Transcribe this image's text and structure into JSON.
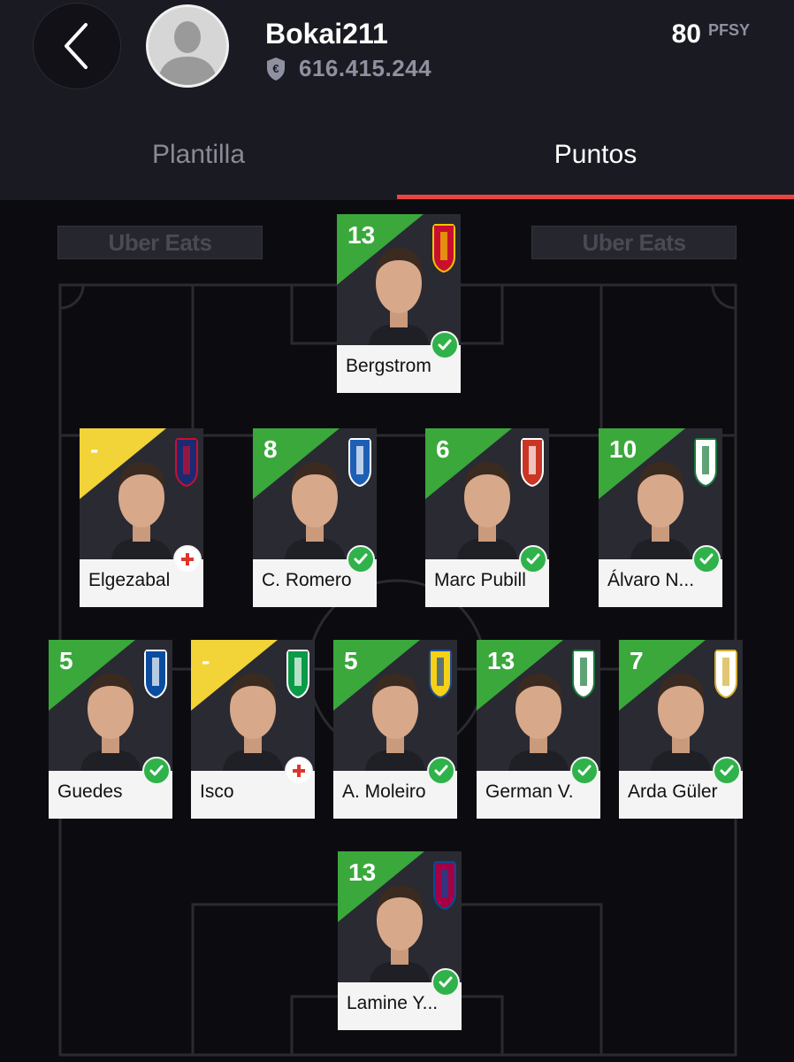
{
  "header": {
    "username": "Bokai211",
    "money": "616.415.244",
    "points": "80",
    "points_unit": "PFSY"
  },
  "tabs": [
    {
      "label": "Plantilla",
      "active": false
    },
    {
      "label": "Puntos",
      "active": true
    }
  ],
  "ads": [
    "Uber Eats",
    "Uber Eats"
  ],
  "colors": {
    "accent_red": "#e9463f",
    "score_green": "#3aa83a",
    "score_yellow": "#f2d338"
  },
  "players": [
    {
      "name": "Bergstrom",
      "score": "13",
      "score_color": "green",
      "status": "ok",
      "badge": "mallorca"
    },
    {
      "name": "Elgezabal",
      "score": "-",
      "score_color": "yellow",
      "status": "injured",
      "badge": "levante"
    },
    {
      "name": "C. Romero",
      "score": "8",
      "score_color": "green",
      "status": "ok",
      "badge": "espanyol"
    },
    {
      "name": "Marc Pubill",
      "score": "6",
      "score_color": "green",
      "status": "ok",
      "badge": "atletico"
    },
    {
      "name": "Álvaro N...",
      "score": "10",
      "score_color": "green",
      "status": "ok",
      "badge": "elche"
    },
    {
      "name": "Guedes",
      "score": "5",
      "score_color": "green",
      "status": "ok",
      "badge": "real-sociedad"
    },
    {
      "name": "Isco",
      "score": "-",
      "score_color": "yellow",
      "status": "injured",
      "badge": "betis"
    },
    {
      "name": "A. Moleiro",
      "score": "5",
      "score_color": "green",
      "status": "ok",
      "badge": "villarreal"
    },
    {
      "name": "German V.",
      "score": "13",
      "score_color": "green",
      "status": "ok",
      "badge": "elche"
    },
    {
      "name": "Arda Güler",
      "score": "7",
      "score_color": "green",
      "status": "ok",
      "badge": "real-madrid"
    },
    {
      "name": "Lamine Y...",
      "score": "13",
      "score_color": "green",
      "status": "ok",
      "badge": "barcelona"
    }
  ]
}
